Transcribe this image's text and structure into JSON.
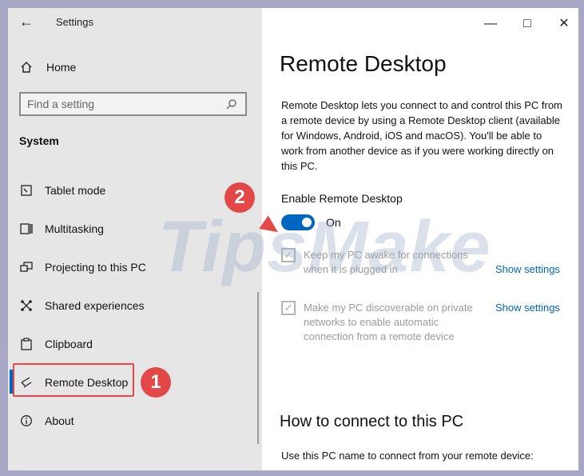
{
  "app": {
    "title": "Settings"
  },
  "sidebar": {
    "home": "Home",
    "search_placeholder": "Find a setting",
    "section": "System",
    "items": [
      {
        "label": "Tablet mode",
        "icon": "tablet-mode-icon"
      },
      {
        "label": "Multitasking",
        "icon": "multitasking-icon"
      },
      {
        "label": "Projecting to this PC",
        "icon": "projecting-icon"
      },
      {
        "label": "Shared experiences",
        "icon": "shared-experiences-icon"
      },
      {
        "label": "Clipboard",
        "icon": "clipboard-icon"
      },
      {
        "label": "Remote Desktop",
        "icon": "remote-desktop-icon",
        "active": true
      },
      {
        "label": "About",
        "icon": "about-icon"
      }
    ]
  },
  "main": {
    "title": "Remote Desktop",
    "description": "Remote Desktop lets you connect to and control this PC from a remote device by using a Remote Desktop client (available for Windows, Android, iOS and macOS). You'll be able to work from another device as if you were working directly on this PC.",
    "enable_label": "Enable Remote Desktop",
    "toggle_state": "On",
    "option1": "Keep my PC awake for connections when it is plugged in",
    "option2": "Make my PC discoverable on private networks to enable automatic connection from a remote device",
    "show_settings": "Show settings",
    "how_title": "How to connect to this PC",
    "bottom_text": "Use this PC name to connect from your remote device:"
  },
  "annotations": {
    "badge1": "1",
    "badge2": "2"
  },
  "watermark": "TipsMake",
  "colors": {
    "accent": "#0067c0",
    "annotation": "#e34747",
    "sidebar_bg": "#e6e6e6",
    "frame": "#a9a7c6"
  }
}
